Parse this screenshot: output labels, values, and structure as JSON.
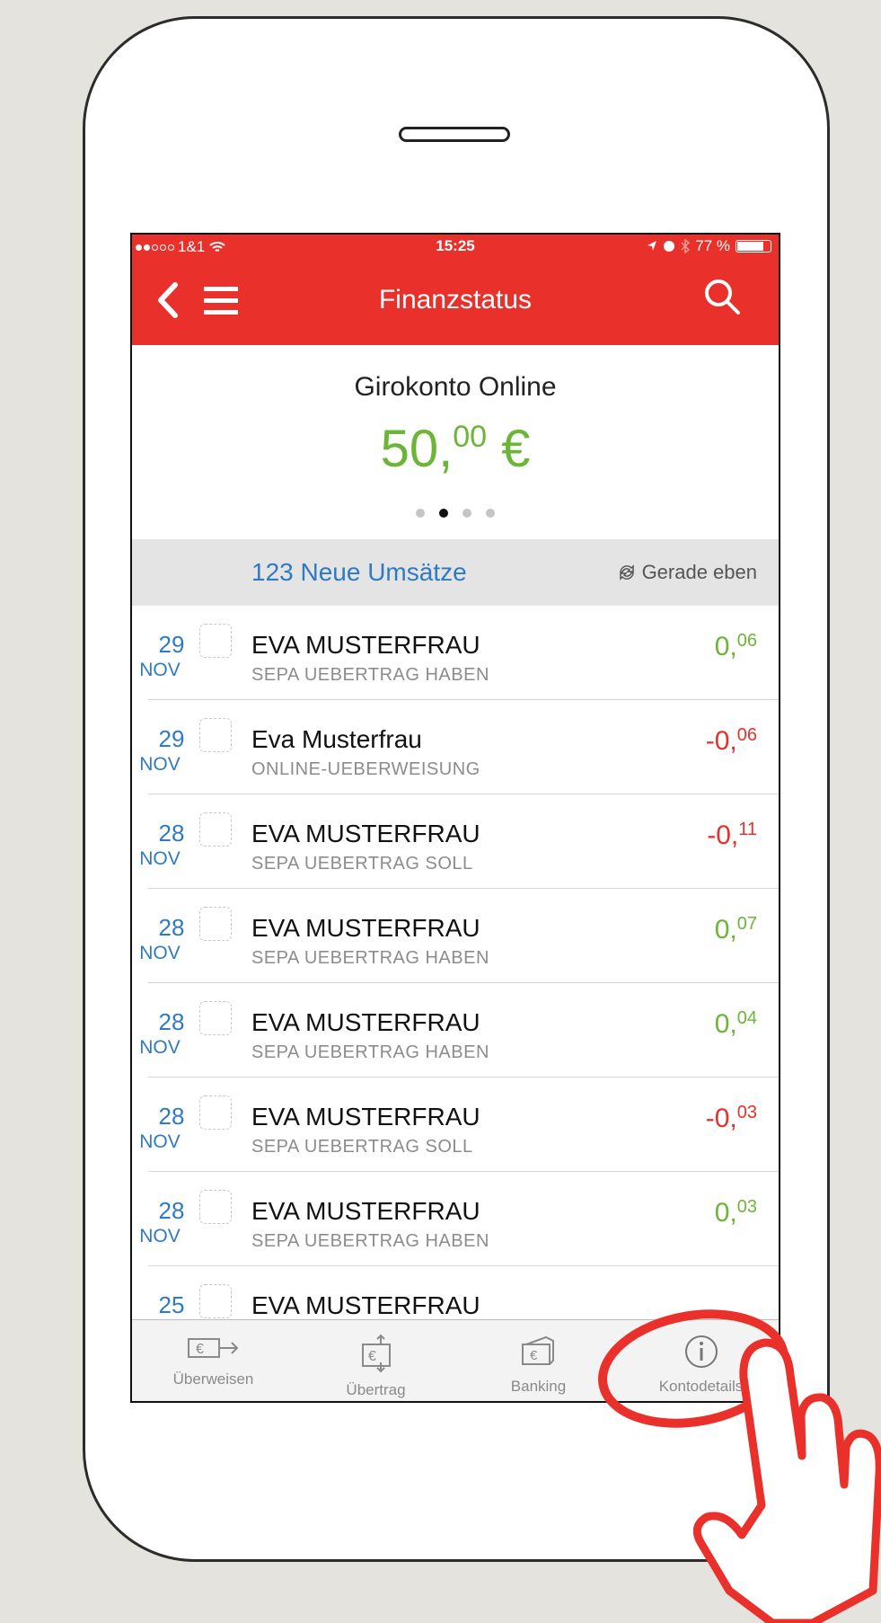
{
  "status_bar": {
    "carrier": "1&1",
    "time": "15:25",
    "battery": "77 %"
  },
  "nav": {
    "title": "Finanzstatus"
  },
  "account": {
    "name": "Girokonto Online",
    "balance_main": "50,",
    "balance_cents": "00",
    "balance_currency": " €"
  },
  "new_bar": {
    "count_label": "123 Neue Umsätze",
    "sync_label": "Gerade eben"
  },
  "transactions": [
    {
      "day": "29",
      "month": "NOV",
      "name": "EVA MUSTERFRAU",
      "desc": "SEPA UEBERTRAG HABEN",
      "amt_main": "0,",
      "amt_cents": "06"
    },
    {
      "day": "29",
      "month": "NOV",
      "name": "Eva Musterfrau",
      "desc": "ONLINE-UEBERWEISUNG",
      "amt_main": "-0,",
      "amt_cents": "06"
    },
    {
      "day": "28",
      "month": "NOV",
      "name": "EVA MUSTERFRAU",
      "desc": "SEPA UEBERTRAG SOLL",
      "amt_main": "-0,",
      "amt_cents": "11"
    },
    {
      "day": "28",
      "month": "NOV",
      "name": "EVA MUSTERFRAU",
      "desc": "SEPA UEBERTRAG HABEN",
      "amt_main": "0,",
      "amt_cents": "07"
    },
    {
      "day": "28",
      "month": "NOV",
      "name": "EVA MUSTERFRAU",
      "desc": "SEPA UEBERTRAG HABEN",
      "amt_main": "0,",
      "amt_cents": "04"
    },
    {
      "day": "28",
      "month": "NOV",
      "name": "EVA MUSTERFRAU",
      "desc": "SEPA UEBERTRAG SOLL",
      "amt_main": "-0,",
      "amt_cents": "03"
    },
    {
      "day": "28",
      "month": "NOV",
      "name": "EVA MUSTERFRAU",
      "desc": "SEPA UEBERTRAG HABEN",
      "amt_main": "0,",
      "amt_cents": "03"
    },
    {
      "day": "25",
      "month": "",
      "name": "EVA MUSTERFRAU",
      "desc": "",
      "amt_main": "",
      "amt_cents": ""
    }
  ],
  "tabs": [
    {
      "label": "Überweisen",
      "icon": "transfer-euro-icon"
    },
    {
      "label": "Übertrag",
      "icon": "swap-euro-icon"
    },
    {
      "label": "Banking",
      "icon": "banking-euro-icon"
    },
    {
      "label": "Kontodetails",
      "icon": "info-icon"
    }
  ],
  "colors": {
    "accent_red": "#e9302a",
    "positive_green": "#6cb537",
    "link_blue": "#2f7ac4"
  }
}
